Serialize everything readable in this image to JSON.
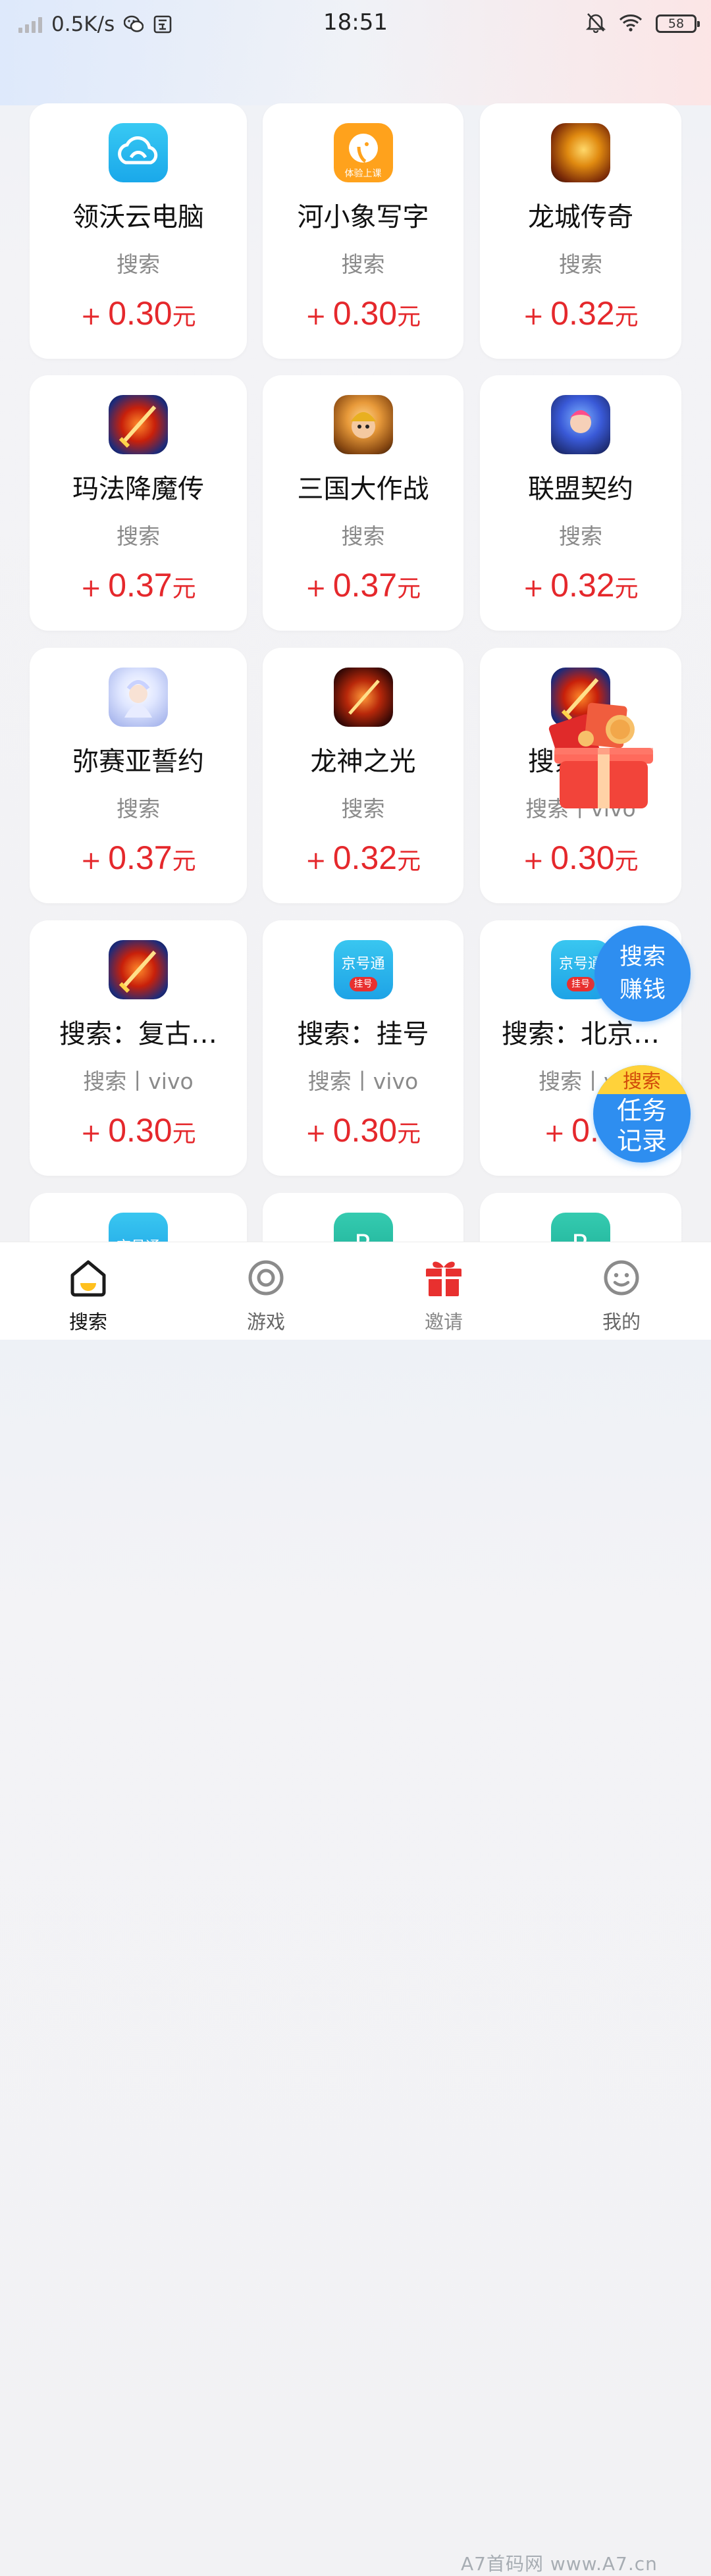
{
  "status_bar": {
    "net_speed": "0.5K/s",
    "time": "18:51",
    "battery": "58",
    "icons": [
      "signal-icon",
      "wechat-icon",
      "message-icon",
      "mute-bell-icon",
      "wifi-icon",
      "battery-icon"
    ]
  },
  "tasks": [
    {
      "name": "领沃云电脑",
      "type": "搜索",
      "plus": "+",
      "amount": "0.30",
      "unit": "元",
      "icon": "cloud-app-icon"
    },
    {
      "name": "河小象写字",
      "type": "搜索",
      "plus": "+",
      "amount": "0.30",
      "unit": "元",
      "icon": "elephant-app-icon"
    },
    {
      "name": "龙城传奇",
      "type": "搜索",
      "plus": "+",
      "amount": "0.32",
      "unit": "元",
      "icon": "dragon-game-icon"
    },
    {
      "name": "玛法降魔传",
      "type": "搜索",
      "plus": "+",
      "amount": "0.37",
      "unit": "元",
      "icon": "sword-game-icon"
    },
    {
      "name": "三国大作战",
      "type": "搜索",
      "plus": "+",
      "amount": "0.37",
      "unit": "元",
      "icon": "warrior-game-icon"
    },
    {
      "name": "联盟契约",
      "type": "搜索",
      "plus": "+",
      "amount": "0.32",
      "unit": "元",
      "icon": "hero-game-icon"
    },
    {
      "name": "弥赛亚誓约",
      "type": "搜索",
      "plus": "+",
      "amount": "0.37",
      "unit": "元",
      "icon": "angel-game-icon"
    },
    {
      "name": "龙神之光",
      "type": "搜索",
      "plus": "+",
      "amount": "0.32",
      "unit": "元",
      "icon": "fire-sword-game-icon"
    },
    {
      "name": "搜索：…",
      "type": "搜索丨vivo",
      "plus": "+",
      "amount": "0.30",
      "unit": "元",
      "icon": "sword-game-icon"
    },
    {
      "name": "搜索：复古…",
      "type": "搜索丨vivo",
      "plus": "+",
      "amount": "0.30",
      "unit": "元",
      "icon": "sword-game-icon"
    },
    {
      "name": "搜索：挂号",
      "type": "搜索丨vivo",
      "plus": "+",
      "amount": "0.30",
      "unit": "元",
      "icon": "jinghaotong-app-icon"
    },
    {
      "name": "搜索：北京…",
      "type": "搜索丨vi",
      "plus": "+",
      "amount": "0.3",
      "unit": "",
      "icon": "jinghaotong-app-icon"
    }
  ],
  "jinghaotong": {
    "title": "京号通",
    "tag": "挂号"
  },
  "elephant_tag": "体验上课",
  "fab_earn": {
    "line1": "搜索",
    "line2": "赚钱"
  },
  "fab_record": {
    "tag": "搜索",
    "line1": "任务",
    "line2": "记录"
  },
  "nav": [
    {
      "label": "搜索",
      "icon": "home-icon",
      "active": true
    },
    {
      "label": "游戏",
      "icon": "target-icon",
      "active": false
    },
    {
      "label": "邀请",
      "icon": "gift-icon",
      "active": false
    },
    {
      "label": "我的",
      "icon": "smiley-icon",
      "active": false
    }
  ],
  "watermark": "A7首码网  www.A7.cn",
  "colors": {
    "reward": "#e5282c",
    "accent_blue": "#2e8ef0",
    "invite_red": "#e8302f"
  }
}
